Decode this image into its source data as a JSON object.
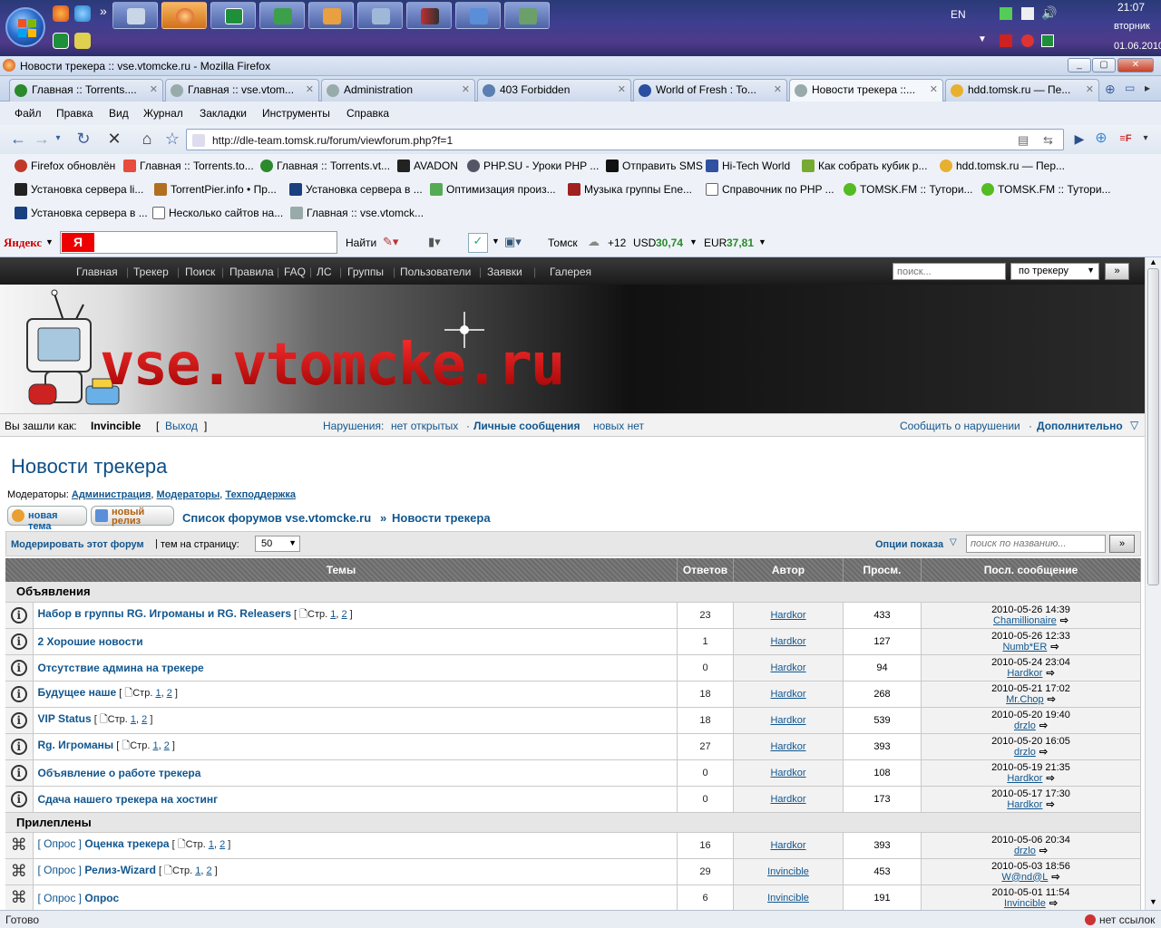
{
  "taskbar": {
    "lang": "EN",
    "time": "21:07",
    "day": "вторник",
    "date": "01.06.2010"
  },
  "window": {
    "title": "Новости трекера :: vse.vtomcke.ru - Mozilla Firefox"
  },
  "tabs": [
    {
      "label": "Главная :: Torrents....",
      "color": "#2b8a2b"
    },
    {
      "label": "Главная :: vse.vtom...",
      "color": "#9aa"
    },
    {
      "label": "Administration",
      "color": "#9aa"
    },
    {
      "label": "403 Forbidden",
      "color": "#5a7fb0"
    },
    {
      "label": "World of Fresh : To...",
      "color": "#2a4fa0"
    },
    {
      "label": "Новости трекера ::...",
      "color": "#9aa",
      "active": true
    },
    {
      "label": "hdd.tomsk.ru — Пе...",
      "color": "#e8b030"
    }
  ],
  "menu": [
    "Файл",
    "Правка",
    "Вид",
    "Журнал",
    "Закладки",
    "Инструменты",
    "Справка"
  ],
  "nav": {
    "url": "http://dle-team.tomsk.ru/forum/viewforum.php?f=1"
  },
  "bookmarks_row1": [
    {
      "label": "Firefox обновлён",
      "color": "#c0392b"
    },
    {
      "label": "Главная :: Torrents.to...",
      "color": "#e74c3c"
    },
    {
      "label": "Главная :: Torrents.vt...",
      "color": "#2b8a2b"
    },
    {
      "label": "AVADON",
      "color": "#222"
    },
    {
      "label": "PHP.SU - Уроки PHP ...",
      "color": "#556"
    },
    {
      "label": "Отправить SMS",
      "color": "#111"
    },
    {
      "label": "Hi-Tech World",
      "color": "#3050a0"
    },
    {
      "label": "Как собрать кубик р...",
      "color": "#7a3"
    },
    {
      "label": "hdd.tomsk.ru — Пер...",
      "color": "#e8b030"
    }
  ],
  "bookmarks_row2": [
    {
      "label": "Установка сервера li...",
      "color": "#222"
    },
    {
      "label": "TorrentPier.info • Пр...",
      "color": "#b07020"
    },
    {
      "label": "Установка сервера в ...",
      "color": "#1a4080"
    },
    {
      "label": "Оптимизация произ...",
      "color": "#5a5"
    },
    {
      "label": "Музыка группы Ene...",
      "color": "#a02020"
    },
    {
      "label": "Справочник по PHP ...",
      "color": "#fff"
    },
    {
      "label": "TOMSK.FM :: Тутори...",
      "color": "#5b2"
    },
    {
      "label": "TOMSK.FM :: Тутори...",
      "color": "#5b2"
    }
  ],
  "bookmarks_row3": [
    {
      "label": "Установка сервера в ...",
      "color": "#1a4080"
    },
    {
      "label": "Несколько сайтов на...",
      "color": "#fff"
    },
    {
      "label": "Главная :: vse.vtomck...",
      "color": "#9aa"
    }
  ],
  "yandex": {
    "brand": "Яндекс",
    "find": "Найти",
    "city": "Томск",
    "temp": "+12",
    "usd_label": "USD",
    "usd": "30,74",
    "eur_label": "EUR",
    "eur": "37,81"
  },
  "site": {
    "nav": [
      "Главная",
      "Трекер",
      "Поиск",
      "Правила",
      "FAQ",
      "ЛС",
      "Группы",
      "Пользователи",
      "Заявки",
      "Галерея"
    ],
    "search_placeholder": "поиск...",
    "search_scope": "по трекеру",
    "go": "»",
    "logo_text": "vse.vtomcke.ru",
    "login_label": "Вы зашли как:",
    "username": "Invincible",
    "logout": "Выход",
    "violations_label": "Нарушения:",
    "violations_value": "нет открытых",
    "pm_label": "Личные сообщения",
    "pm_value": "новых нет",
    "report": "Сообщить о нарушении",
    "more": "Дополнительно"
  },
  "forum": {
    "title": "Новости трекера",
    "moderators_label": "Модераторы:",
    "moderators": [
      "Администрация",
      "Модераторы",
      "Техподдержка"
    ],
    "btn_new_topic": "новая тема",
    "btn_new_release": "новый релиз",
    "crumb_root": "Список форумов vse.vtomcke.ru",
    "crumb_sep": "»",
    "crumb_current": "Новости трекера",
    "moderate": "Модерировать этот форум",
    "per_page_label": "тем на страницу:",
    "per_page": "50",
    "options": "Опции показа",
    "title_search_placeholder": "поиск по названию...",
    "columns": [
      "Темы",
      "Ответов",
      "Автор",
      "Просм.",
      "Посл. сообщение"
    ],
    "sections": [
      {
        "name": "Объявления",
        "topics": [
          {
            "title": "Набор в группы RG. Игроманы и RG. Releasers",
            "pages": true,
            "replies": "23",
            "author": "Hardkor",
            "views": "433",
            "last_date": "2010-05-26 14:39",
            "last_user": "Chamillionaire"
          },
          {
            "title": "2 Хорошие новости",
            "pages": false,
            "replies": "1",
            "author": "Hardkor",
            "views": "127",
            "last_date": "2010-05-26 12:33",
            "last_user": "Numb*ER"
          },
          {
            "title": "Отсутствие админа на трекере",
            "pages": false,
            "replies": "0",
            "author": "Hardkor",
            "views": "94",
            "last_date": "2010-05-24 23:04",
            "last_user": "Hardkor"
          },
          {
            "title": "Будущее наше",
            "pages": true,
            "replies": "18",
            "author": "Hardkor",
            "views": "268",
            "last_date": "2010-05-21 17:02",
            "last_user": "Mr.Chop"
          },
          {
            "title": "VIP Status",
            "pages": true,
            "replies": "18",
            "author": "Hardkor",
            "views": "539",
            "last_date": "2010-05-20 19:40",
            "last_user": "drzlo"
          },
          {
            "title": "Rg. Игроманы",
            "pages": true,
            "replies": "27",
            "author": "Hardkor",
            "views": "393",
            "last_date": "2010-05-20 16:05",
            "last_user": "drzlo"
          },
          {
            "title": "Объявление о работе трекера",
            "pages": false,
            "replies": "0",
            "author": "Hardkor",
            "views": "108",
            "last_date": "2010-05-19 21:35",
            "last_user": "Hardkor"
          },
          {
            "title": "Сдача нашего трекера на хостинг",
            "pages": false,
            "replies": "0",
            "author": "Hardkor",
            "views": "173",
            "last_date": "2010-05-17 17:30",
            "last_user": "Hardkor"
          }
        ]
      },
      {
        "name": "Прилеплены",
        "topics": [
          {
            "prefix": "[ Опрос ]",
            "title": "Оценка трекера",
            "pages": true,
            "replies": "16",
            "author": "Hardkor",
            "views": "393",
            "last_date": "2010-05-06 20:34",
            "last_user": "drzlo"
          },
          {
            "prefix": "[ Опрос ]",
            "title": "Релиз-Wizard",
            "pages": true,
            "replies": "29",
            "author": "Invincible",
            "views": "453",
            "last_date": "2010-05-03 18:56",
            "last_user": "W@nd@L"
          },
          {
            "prefix": "[ Опрос ]",
            "title": "Опрос",
            "pages": false,
            "replies": "6",
            "author": "Invincible",
            "views": "191",
            "last_date": "2010-05-01 11:54",
            "last_user": "Invincible"
          }
        ]
      }
    ],
    "pages_label": "Стр.",
    "page1": "1",
    "page2": "2"
  },
  "status": {
    "left": "Готово",
    "right": "нет ссылок"
  }
}
